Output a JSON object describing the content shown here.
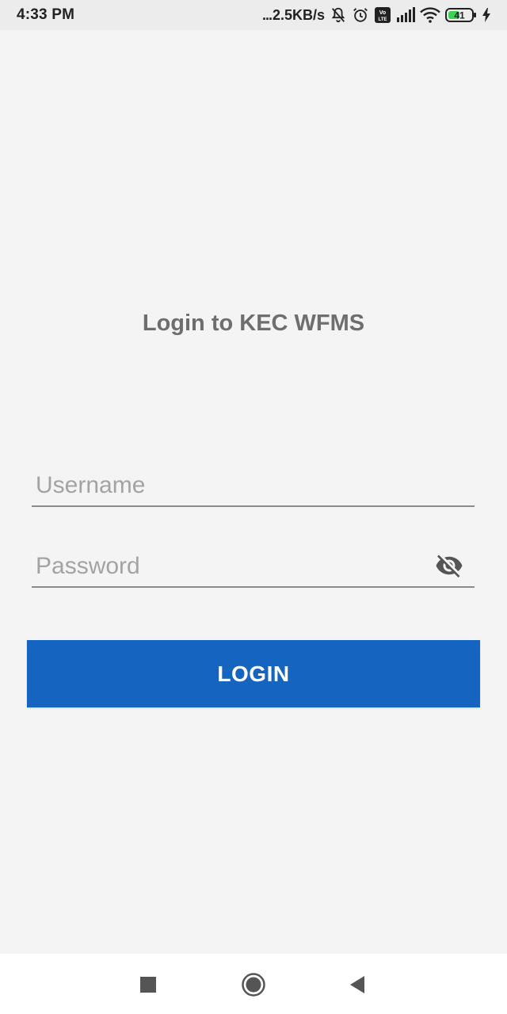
{
  "status_bar": {
    "time": "4:33 PM",
    "net_speed_dots": "...",
    "net_speed": "2.5KB/s",
    "battery_level": "41",
    "icons": [
      "notifications-off-icon",
      "alarm-icon",
      "volte-icon",
      "signal-icon",
      "wifi-icon",
      "battery-icon",
      "charging-icon"
    ]
  },
  "login": {
    "title": "Login to KEC WFMS",
    "username_placeholder": "Username",
    "username_value": "",
    "password_placeholder": "Password",
    "password_value": "",
    "password_toggle_icon": "visibility-off-icon",
    "button_label": "LOGIN",
    "button_color": "#1565c0"
  },
  "nav_bar": {
    "icons": [
      "recents-square-icon",
      "home-circle-icon",
      "back-triangle-icon"
    ]
  }
}
